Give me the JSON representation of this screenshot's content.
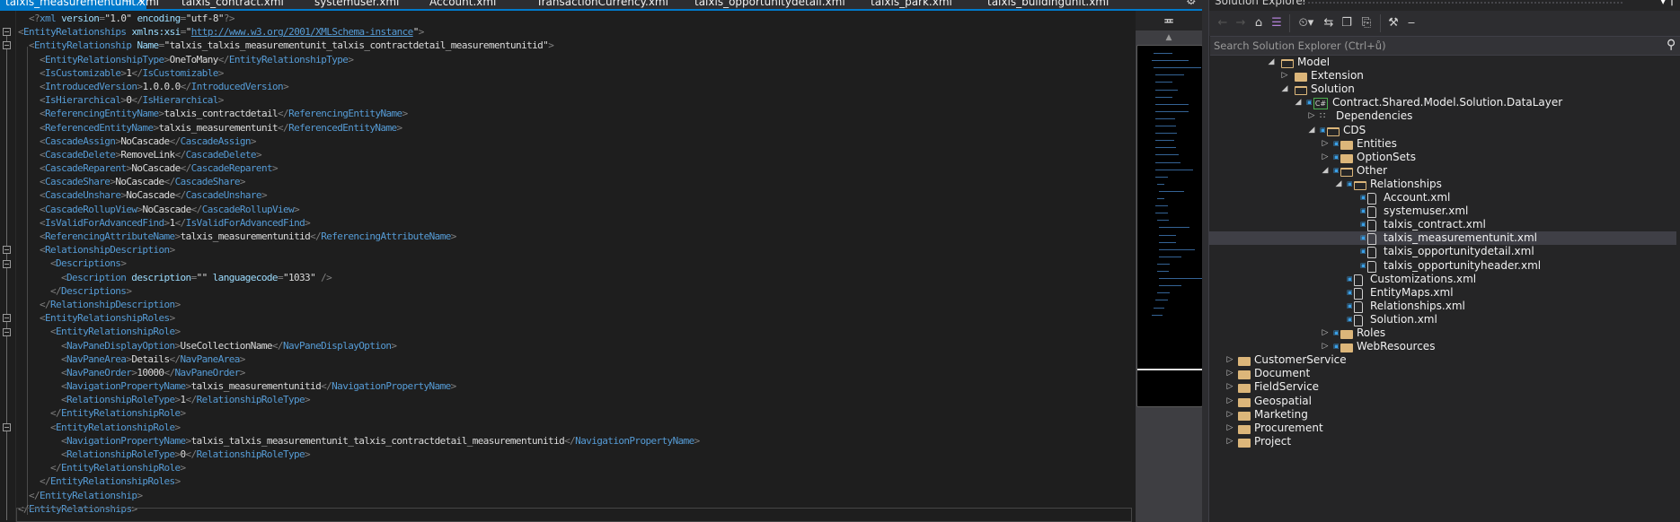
{
  "tabs": [
    {
      "label": "talxis_measurementunit.xml",
      "active": true
    },
    {
      "label": "talxis_contract.xml"
    },
    {
      "label": "systemuser.xml"
    },
    {
      "label": "Account.xml"
    },
    {
      "label": "TransactionCurrency.xml"
    },
    {
      "label": "talxis_opportunitydetail.xml"
    },
    {
      "label": "talxis_park.xml"
    },
    {
      "label": "talxis_buildingunit.xml"
    }
  ],
  "tab_pin_icon": "pin-icon",
  "tab_close_icon": "close-icon",
  "editor": {
    "lines": [
      {
        "indent": 1,
        "parts": [
          [
            "b",
            "<?"
          ],
          [
            "t",
            "xml"
          ],
          [
            "a",
            " version"
          ],
          [
            "b",
            "="
          ],
          [
            "s2",
            "\"1.0\""
          ],
          [
            "a",
            " encoding"
          ],
          [
            "b",
            "="
          ],
          [
            "s2",
            "\"utf-8\""
          ],
          [
            "b",
            "?>"
          ]
        ]
      },
      {
        "indent": 0,
        "fold": true,
        "parts": [
          [
            "b",
            "<"
          ],
          [
            "t",
            "EntityRelationships"
          ],
          [
            "a",
            " xmlns:xsi"
          ],
          [
            "b",
            "="
          ],
          [
            "s2",
            "\""
          ],
          [
            "u",
            "http://www.w3.org/2001/XMLSchema-instance"
          ],
          [
            "s2",
            "\""
          ],
          [
            "b",
            ">"
          ]
        ]
      },
      {
        "indent": 1,
        "fold": true,
        "parts": [
          [
            "b",
            "<"
          ],
          [
            "t",
            "EntityRelationship"
          ],
          [
            "a",
            " Name"
          ],
          [
            "b",
            "="
          ],
          [
            "s2",
            "\"talxis_talxis_measurementunit_talxis_contractdetail_measurementunitid\""
          ],
          [
            "b",
            ">"
          ]
        ]
      },
      {
        "indent": 2,
        "tag": "EntityRelationshipType",
        "value": "OneToMany"
      },
      {
        "indent": 2,
        "tag": "IsCustomizable",
        "value": "1"
      },
      {
        "indent": 2,
        "tag": "IntroducedVersion",
        "value": "1.0.0.0"
      },
      {
        "indent": 2,
        "tag": "IsHierarchical",
        "value": "0"
      },
      {
        "indent": 2,
        "tag": "ReferencingEntityName",
        "value": "talxis_contractdetail"
      },
      {
        "indent": 2,
        "tag": "ReferencedEntityName",
        "value": "talxis_measurementunit"
      },
      {
        "indent": 2,
        "tag": "CascadeAssign",
        "value": "NoCascade"
      },
      {
        "indent": 2,
        "tag": "CascadeDelete",
        "value": "RemoveLink"
      },
      {
        "indent": 2,
        "tag": "CascadeReparent",
        "value": "NoCascade"
      },
      {
        "indent": 2,
        "tag": "CascadeShare",
        "value": "NoCascade"
      },
      {
        "indent": 2,
        "tag": "CascadeUnshare",
        "value": "NoCascade"
      },
      {
        "indent": 2,
        "tag": "CascadeRollupView",
        "value": "NoCascade"
      },
      {
        "indent": 2,
        "tag": "IsValidForAdvancedFind",
        "value": "1"
      },
      {
        "indent": 2,
        "tag": "ReferencingAttributeName",
        "value": "talxis_measurementunitid"
      },
      {
        "indent": 2,
        "fold": true,
        "parts": [
          [
            "b",
            "<"
          ],
          [
            "t",
            "RelationshipDescription"
          ],
          [
            "b",
            ">"
          ]
        ]
      },
      {
        "indent": 3,
        "fold": true,
        "parts": [
          [
            "b",
            "<"
          ],
          [
            "t",
            "Descriptions"
          ],
          [
            "b",
            ">"
          ]
        ]
      },
      {
        "indent": 4,
        "parts": [
          [
            "b",
            "<"
          ],
          [
            "t",
            "Description"
          ],
          [
            "a",
            " description"
          ],
          [
            "b",
            "="
          ],
          [
            "s2",
            "\"\""
          ],
          [
            "a",
            " languagecode"
          ],
          [
            "b",
            "="
          ],
          [
            "s2",
            "\"1033\""
          ],
          [
            "b",
            " />"
          ]
        ]
      },
      {
        "indent": 3,
        "parts": [
          [
            "b",
            "</"
          ],
          [
            "t",
            "Descriptions"
          ],
          [
            "b",
            ">"
          ]
        ]
      },
      {
        "indent": 2,
        "parts": [
          [
            "b",
            "</"
          ],
          [
            "t",
            "RelationshipDescription"
          ],
          [
            "b",
            ">"
          ]
        ]
      },
      {
        "indent": 2,
        "fold": true,
        "parts": [
          [
            "b",
            "<"
          ],
          [
            "t",
            "EntityRelationshipRoles"
          ],
          [
            "b",
            ">"
          ]
        ]
      },
      {
        "indent": 3,
        "fold": true,
        "parts": [
          [
            "b",
            "<"
          ],
          [
            "t",
            "EntityRelationshipRole"
          ],
          [
            "b",
            ">"
          ]
        ]
      },
      {
        "indent": 4,
        "tag": "NavPaneDisplayOption",
        "value": "UseCollectionName"
      },
      {
        "indent": 4,
        "tag": "NavPaneArea",
        "value": "Details"
      },
      {
        "indent": 4,
        "tag": "NavPaneOrder",
        "value": "10000"
      },
      {
        "indent": 4,
        "tag": "NavigationPropertyName",
        "value": "talxis_measurementunitid"
      },
      {
        "indent": 4,
        "tag": "RelationshipRoleType",
        "value": "1"
      },
      {
        "indent": 3,
        "parts": [
          [
            "b",
            "</"
          ],
          [
            "t",
            "EntityRelationshipRole"
          ],
          [
            "b",
            ">"
          ]
        ]
      },
      {
        "indent": 3,
        "fold": true,
        "parts": [
          [
            "b",
            "<"
          ],
          [
            "t",
            "EntityRelationshipRole"
          ],
          [
            "b",
            ">"
          ]
        ]
      },
      {
        "indent": 4,
        "tag": "NavigationPropertyName",
        "value": "talxis_talxis_measurementunit_talxis_contractdetail_measurementunitid"
      },
      {
        "indent": 4,
        "tag": "RelationshipRoleType",
        "value": "0"
      },
      {
        "indent": 3,
        "parts": [
          [
            "b",
            "</"
          ],
          [
            "t",
            "EntityRelationshipRole"
          ],
          [
            "b",
            ">"
          ]
        ]
      },
      {
        "indent": 2,
        "parts": [
          [
            "b",
            "</"
          ],
          [
            "t",
            "EntityRelationshipRoles"
          ],
          [
            "b",
            ">"
          ]
        ]
      },
      {
        "indent": 1,
        "parts": [
          [
            "b",
            "</"
          ],
          [
            "t",
            "EntityRelationship"
          ],
          [
            "b",
            ">"
          ]
        ]
      },
      {
        "indent": 0,
        "parts": [
          [
            "b",
            "</"
          ],
          [
            "t",
            "EntityRelationships"
          ],
          [
            "b",
            ">"
          ]
        ]
      }
    ]
  },
  "split_button_icon": "split-window-icon",
  "scroll_up_icon": "scroll-up-arrow-icon",
  "solution_explorer": {
    "title": "Solution Explorer",
    "title_buttons": "▾ †",
    "toolbar": [
      {
        "name": "back-icon",
        "glyph": "←",
        "dim": true
      },
      {
        "name": "forward-icon",
        "glyph": "→",
        "dim": true
      },
      {
        "name": "home-icon",
        "glyph": "⌂"
      },
      {
        "name": "vs-solution-icon",
        "glyph": "☰"
      },
      {
        "name": "pending-changes-icon",
        "glyph": "⏲▾"
      },
      {
        "name": "sync-icon",
        "glyph": "⇆"
      },
      {
        "name": "collapse-all-icon",
        "glyph": "❐"
      },
      {
        "name": "show-all-files-icon",
        "glyph": "⎘"
      },
      {
        "name": "properties-wrench-icon",
        "glyph": "⚒"
      },
      {
        "name": "preview-icon",
        "glyph": "‒"
      }
    ],
    "search_placeholder": "Search Solution Explorer (Ctrl+ů)",
    "tree": [
      {
        "label": "Model",
        "level": 0,
        "expanded": true,
        "icon": "folder-open"
      },
      {
        "label": "Extension",
        "level": 1,
        "expanded": false,
        "icon": "folder"
      },
      {
        "label": "Solution",
        "level": 1,
        "expanded": true,
        "icon": "folder-open"
      },
      {
        "label": "Contract.Shared.Model.Solution.DataLayer",
        "level": 2,
        "expanded": true,
        "icon": "csharp-project",
        "lock": true
      },
      {
        "label": "Dependencies",
        "level": 3,
        "expanded": false,
        "icon": "dependencies"
      },
      {
        "label": "CDS",
        "level": 3,
        "expanded": true,
        "icon": "folder-open",
        "lock": true
      },
      {
        "label": "Entities",
        "level": 4,
        "expanded": false,
        "icon": "folder",
        "lock": true
      },
      {
        "label": "OptionSets",
        "level": 4,
        "expanded": false,
        "icon": "folder",
        "lock": true
      },
      {
        "label": "Other",
        "level": 4,
        "expanded": true,
        "icon": "folder-open",
        "lock": true
      },
      {
        "label": "Relationships",
        "level": 5,
        "expanded": true,
        "icon": "folder-open",
        "lock": true
      },
      {
        "label": "Account.xml",
        "level": 6,
        "icon": "xml-file",
        "lock": true
      },
      {
        "label": "systemuser.xml",
        "level": 6,
        "icon": "xml-file",
        "lock": true
      },
      {
        "label": "talxis_contract.xml",
        "level": 6,
        "icon": "xml-file",
        "lock": true
      },
      {
        "label": "talxis_measurementunit.xml",
        "level": 6,
        "icon": "xml-file",
        "lock": true,
        "selected": true
      },
      {
        "label": "talxis_opportunitydetail.xml",
        "level": 6,
        "icon": "xml-file",
        "lock": true
      },
      {
        "label": "talxis_opportunityheader.xml",
        "level": 6,
        "icon": "xml-file",
        "lock": true
      },
      {
        "label": "Customizations.xml",
        "level": 5,
        "icon": "xml-file",
        "lock": true
      },
      {
        "label": "EntityMaps.xml",
        "level": 5,
        "icon": "xml-file",
        "lock": true
      },
      {
        "label": "Relationships.xml",
        "level": 5,
        "icon": "xml-file",
        "lock": true
      },
      {
        "label": "Solution.xml",
        "level": 5,
        "icon": "xml-file",
        "lock": true
      },
      {
        "label": "Roles",
        "level": 4,
        "expanded": false,
        "icon": "folder",
        "lock": true
      },
      {
        "label": "WebResources",
        "level": 4,
        "expanded": false,
        "icon": "folder",
        "lock": true
      },
      {
        "label": "CustomerService",
        "level": -1,
        "expanded": false,
        "icon": "folder"
      },
      {
        "label": "Document",
        "level": -1,
        "expanded": false,
        "icon": "folder"
      },
      {
        "label": "FieldService",
        "level": -1,
        "expanded": false,
        "icon": "folder"
      },
      {
        "label": "Geospatial",
        "level": -1,
        "expanded": false,
        "icon": "folder"
      },
      {
        "label": "Marketing",
        "level": -1,
        "expanded": false,
        "icon": "folder"
      },
      {
        "label": "Procurement",
        "level": -1,
        "expanded": false,
        "icon": "folder"
      },
      {
        "label": "Project",
        "level": -1,
        "expanded": false,
        "icon": "folder"
      }
    ]
  }
}
